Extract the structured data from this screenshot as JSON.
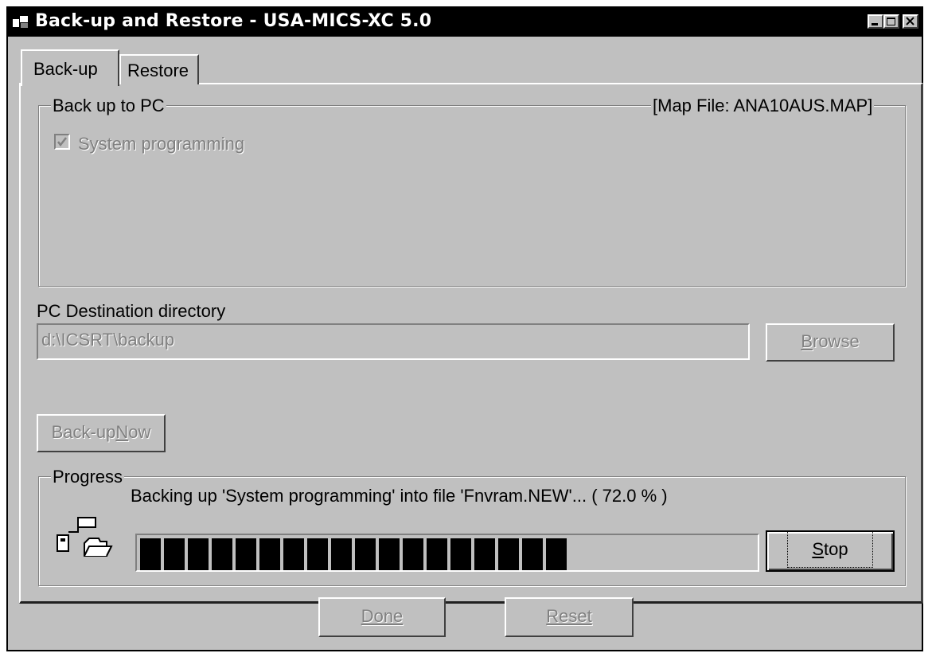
{
  "window": {
    "title": "Back-up and Restore - USA-MICS-XC 5.0",
    "controls": {
      "minimize_icon": "minimize-icon",
      "maximize_icon": "maximize-icon",
      "close_icon": "close-icon"
    }
  },
  "tabs": [
    {
      "label": "Back-up",
      "active": true
    },
    {
      "label": "Restore",
      "active": false
    }
  ],
  "backup_group": {
    "legend": "Back up to PC",
    "map_file": "[Map File:  ANA10AUS.MAP]",
    "items": [
      {
        "label": "System programming",
        "checked": true,
        "enabled": false
      }
    ]
  },
  "destination": {
    "label": "PC Destination directory",
    "value": "d:\\ICSRT\\backup",
    "browse_label": "Browse",
    "browse_mnemonic": "B"
  },
  "backup_now": {
    "label": "Back-up Now",
    "prefix": "Back-up ",
    "mnemonic": "N",
    "suffix": "ow"
  },
  "progress": {
    "legend": "Progress",
    "status": "Backing up 'System programming' into file 'Fnvram.NEW'...  ( 72.0 % )",
    "percent": 72.0,
    "stop_label": "Stop",
    "stop_mnemonic": "S"
  },
  "footer": {
    "done_label": "Done",
    "reset_label": "Reset"
  },
  "colors": {
    "face": "#c0c0c0",
    "titlebar": "#000000",
    "progress_fill": "#000000",
    "disabled_text": "#808080"
  }
}
